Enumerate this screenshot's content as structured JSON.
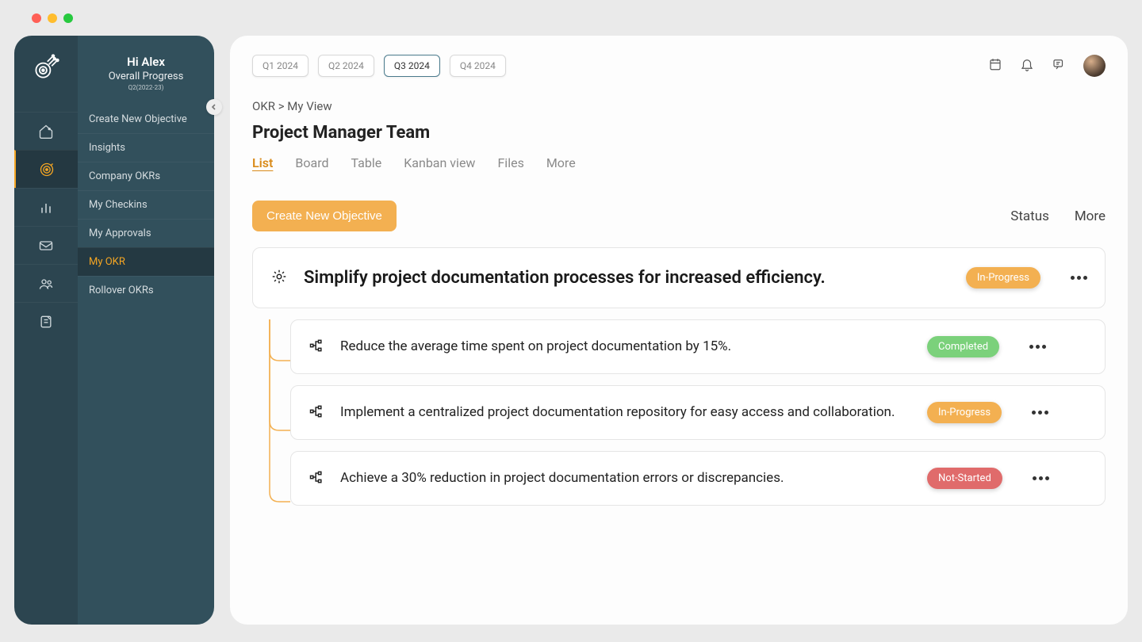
{
  "greeting": "Hi Alex",
  "overall_label": "Overall Progress",
  "period_label": "Q2(2022-23)",
  "submenu": {
    "items": [
      {
        "label": "Create New Objective"
      },
      {
        "label": "Insights"
      },
      {
        "label": "Company OKRs"
      },
      {
        "label": "My  Checkins"
      },
      {
        "label": "My Approvals"
      },
      {
        "label": "My OKR"
      },
      {
        "label": "Rollover OKRs"
      }
    ]
  },
  "quarters": [
    {
      "label": "Q1 2024"
    },
    {
      "label": "Q2 2024"
    },
    {
      "label": "Q3 2024"
    },
    {
      "label": "Q4 2024"
    }
  ],
  "breadcrumb": {
    "root": "OKR",
    "sep": " > ",
    "current": "My View"
  },
  "team_title": "Project Manager Team",
  "view_tabs": [
    {
      "label": "List"
    },
    {
      "label": "Board"
    },
    {
      "label": "Table"
    },
    {
      "label": "Kanban view"
    },
    {
      "label": "Files"
    },
    {
      "label": "More"
    }
  ],
  "create_label": "Create New Objective",
  "toolbar": {
    "status": "Status",
    "more": "More"
  },
  "objective": {
    "title": "Simplify project documentation processes for increased efficiency.",
    "status": "In-Progress"
  },
  "key_results": [
    {
      "title": "Reduce the average time spent on project documentation by 15%.",
      "status": "Completed",
      "pill": "complete"
    },
    {
      "title": "Implement a centralized project documentation repository for easy access and collaboration.",
      "status": "In-Progress",
      "pill": "progress"
    },
    {
      "title": "Achieve a 30% reduction in project documentation errors or discrepancies.",
      "status": "Not-Started",
      "pill": "notstarted"
    }
  ]
}
